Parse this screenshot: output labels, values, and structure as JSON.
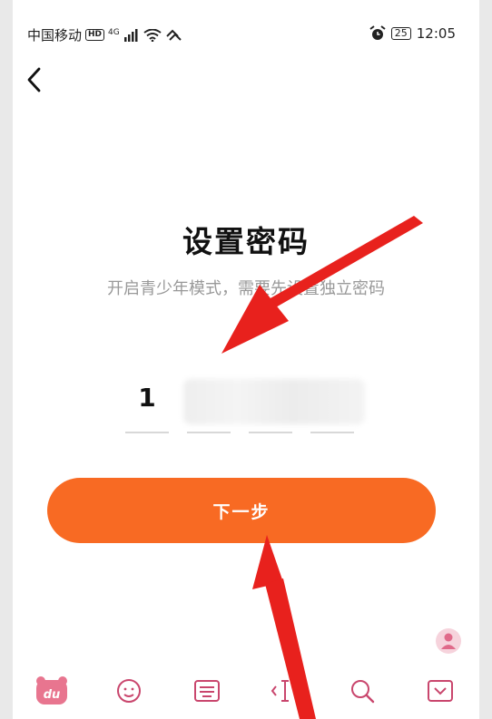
{
  "status_bar": {
    "carrier": "中国移动",
    "hd_badge": "HD",
    "network": "4G",
    "battery": "25",
    "time": "12:05"
  },
  "page": {
    "title": "设置密码",
    "subtitle": "开启青少年模式，需要先设置独立密码"
  },
  "pin": {
    "digits": [
      "1",
      "",
      "",
      ""
    ]
  },
  "actions": {
    "next_label": "下一步"
  },
  "keyboard_toolbar": {
    "icons": [
      "du-logo-icon",
      "emoji-icon",
      "keyboard-icon",
      "cursor-icon",
      "search-icon",
      "collapse-keyboard-icon"
    ]
  },
  "colors": {
    "accent": "#f86a23",
    "annotation_arrow": "#e8211d",
    "toolbar_icon": "#c9466d"
  }
}
